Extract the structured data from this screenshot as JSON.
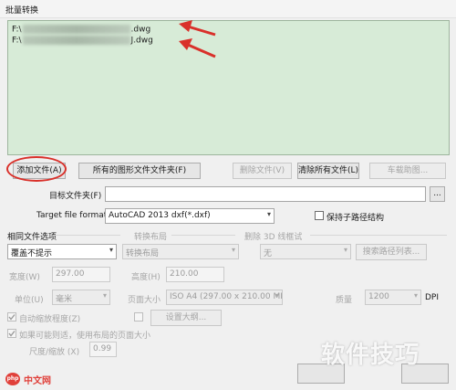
{
  "window": {
    "title": "批量转换"
  },
  "file_list": {
    "items": [
      {
        "prefix": "F:\\",
        "suffix": ".dwg"
      },
      {
        "prefix": "F:\\",
        "suffix": "J.dwg"
      }
    ]
  },
  "buttons": {
    "add_file": "添加文件(A)",
    "all_drawings_folder": "所有的图形文件文件夹(F)",
    "delete_file": "删除文件(V)",
    "clear_all": "清除所有文件(L)",
    "add_to_convert": "车载助图...",
    "browse": "...",
    "plot_style_list": "搜索路径列表...",
    "settings": "设置大纲..."
  },
  "target_folder": {
    "label": "目标文件夹(F)",
    "value": ""
  },
  "target_format": {
    "label": "Target file format",
    "value": "AutoCAD 2013 dxf(*.dxf)"
  },
  "keep_subfolder": {
    "label": "保持子路径结构",
    "checked": false
  },
  "same_name_options": {
    "heading": "相同文件选项",
    "value": "覆盖不提示"
  },
  "convert_layout": {
    "heading": "转换布局",
    "value": "转换布局"
  },
  "delete_3d": {
    "heading": "删除 3D 线框试",
    "value": "无"
  },
  "width": {
    "label": "宽度(W)",
    "value": "297.00"
  },
  "height": {
    "label": "高度(H)",
    "value": "210.00"
  },
  "units": {
    "label": "单位(U)",
    "value": "毫米"
  },
  "page_size": {
    "label": "页面大小",
    "value": "ISO A4 (297.00 x 210.00 MM)"
  },
  "quality": {
    "label": "质量",
    "value": "1200",
    "unit": "DPI"
  },
  "auto_scale": {
    "label": "自动缩放程度(Z)",
    "checked": true
  },
  "fit_layout": {
    "label": "如果可能则适，使用布局的页面大小",
    "checked": true
  },
  "scale_ratio": {
    "label": "尺度/缩放 (X)",
    "value": "0.99"
  },
  "watermark": {
    "text": "软件技巧",
    "site": "中文网",
    "logo": "php"
  }
}
